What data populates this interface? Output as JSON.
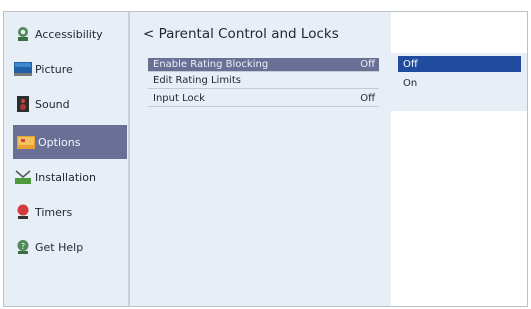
{
  "sidebar": {
    "items": [
      {
        "label": "Accessibility",
        "icon": "accessibility-icon"
      },
      {
        "label": "Picture",
        "icon": "picture-icon"
      },
      {
        "label": "Sound",
        "icon": "sound-icon"
      },
      {
        "label": "Options",
        "icon": "options-icon",
        "selected": true
      },
      {
        "label": "Installation",
        "icon": "installation-icon"
      },
      {
        "label": "Timers",
        "icon": "timers-icon"
      },
      {
        "label": "Get Help",
        "icon": "help-icon"
      }
    ]
  },
  "main": {
    "title": "< Parental Control and Locks",
    "rows": [
      {
        "label": "Enable Rating Blocking",
        "value": "Off",
        "selected": true
      },
      {
        "label": "Edit Rating Limits",
        "value": ""
      },
      {
        "label": "Input Lock",
        "value": "Off"
      }
    ]
  },
  "popup": {
    "options": [
      {
        "label": "Off",
        "selected": true
      },
      {
        "label": "On"
      }
    ]
  },
  "colors": {
    "background": "#e8eef6",
    "selected_menu": "#6a6f96",
    "selected_option": "#1f4c9f"
  }
}
